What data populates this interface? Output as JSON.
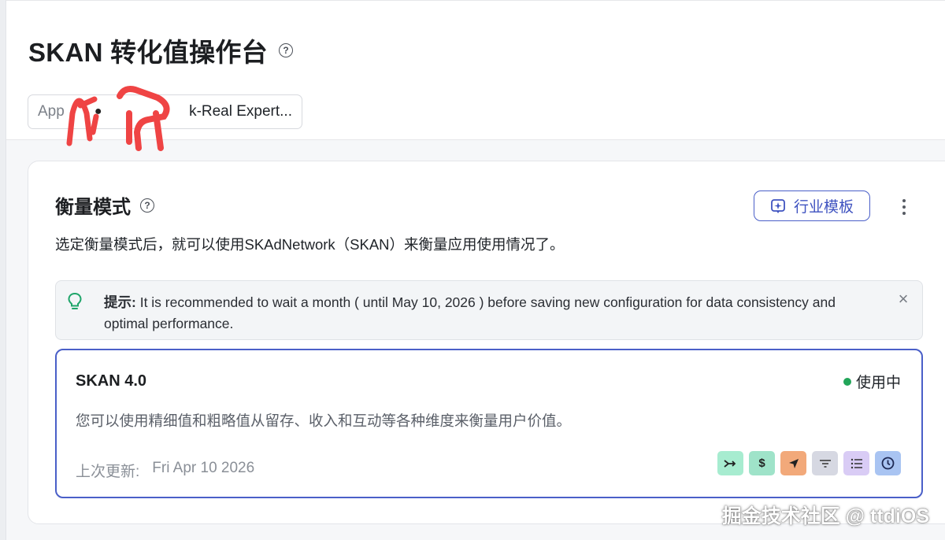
{
  "header": {
    "title": "SKAN 转化值操作台",
    "help_icon": "question-circle-icon"
  },
  "app_selector": {
    "label": "App",
    "platform_icon": "apple-icon",
    "value": "k-Real Expert..."
  },
  "measurement": {
    "title": "衡量模式",
    "description": "选定衡量模式后，就可以使用SKAdNetwork（SKAN）来衡量应用使用情况了。",
    "industry_template_label": "行业模板",
    "tip": {
      "prefix": "提示:",
      "text": "It is recommended to wait a month ( until May 10, 2026 ) before saving new configuration for data consistency and optimal performance."
    },
    "mode_card": {
      "title": "SKAN 4.0",
      "status": "使用中",
      "description": "您可以使用精细值和粗略值从留存、收入和互动等各种维度来衡量用户价值。",
      "updated_label": "上次更新:",
      "updated_value": "Fri Apr 10 2026",
      "feature_icons": [
        {
          "name": "merge-icon",
          "color": "#a7ecd0"
        },
        {
          "name": "dollar-icon",
          "color": "#9fe3c9"
        },
        {
          "name": "navigation-arrow-icon",
          "color": "#f2a97a"
        },
        {
          "name": "filter-icon",
          "color": "#d6d8e2"
        },
        {
          "name": "list-icon",
          "color": "#d9ccf5"
        },
        {
          "name": "clock-icon",
          "color": "#a9c4f2"
        }
      ]
    }
  },
  "watermark": "掘金技术社区 @ ttdiOS",
  "colors": {
    "accent": "#4a5fc8",
    "status_active": "#22a559"
  }
}
